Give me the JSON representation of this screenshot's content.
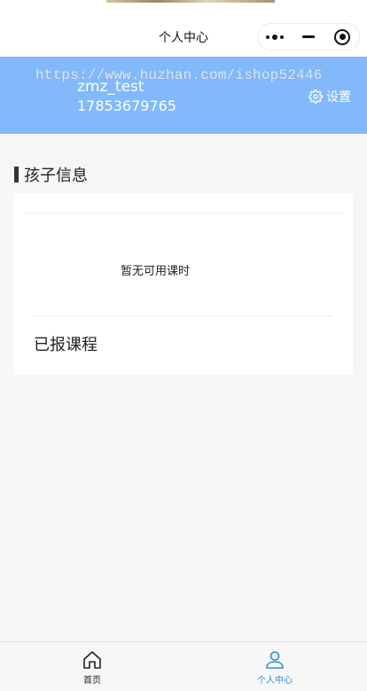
{
  "nav": {
    "title": "个人中心",
    "capsule": {
      "more_icon": "more-dots-icon",
      "minimize_icon": "minimize-icon",
      "close_icon": "target-close-icon"
    }
  },
  "header": {
    "watermark": "https://www.huzhan.com/ishop52446",
    "username": "zmz_test",
    "phone": "17853679765",
    "settings_label": "设置",
    "background_color": "#82b9fb"
  },
  "child_info": {
    "section_title": "孩子信息",
    "empty_message": "暂无可用课时",
    "enrolled_courses_title": "已报课程"
  },
  "tabbar": {
    "items": [
      {
        "label": "首页",
        "icon": "home-icon",
        "active": false
      },
      {
        "label": "个人中心",
        "icon": "user-icon",
        "active": true
      }
    ],
    "active_color": "#2a8fd6"
  }
}
